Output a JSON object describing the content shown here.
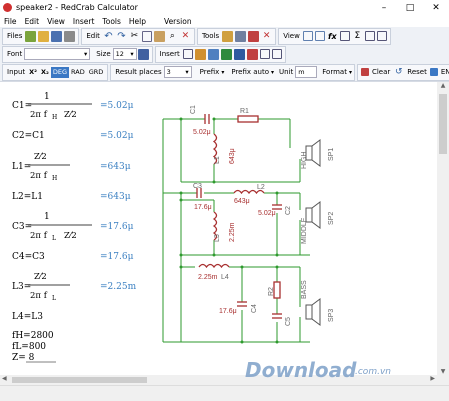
{
  "window": {
    "title": "speaker2 - RedCrab Calculator",
    "minimize": "–",
    "maximize": "□",
    "close": "✕"
  },
  "menu": [
    "File",
    "Edit",
    "View",
    "Insert",
    "Tools",
    "Help",
    "Version"
  ],
  "toolbar1": {
    "files": "Files",
    "edit": "Edit",
    "tools": "Tools",
    "view": "View",
    "fx": "fx"
  },
  "toolbar2": {
    "font_label": "Font",
    "size_label": "Size",
    "size_value": "12",
    "insert_label": "Insert"
  },
  "toolbar3": {
    "input": "Input",
    "x2": "X²",
    "x_sub": "X₂",
    "deg": "DEG",
    "rad": "RAD",
    "grd": "GRD",
    "result_places": "Result places",
    "result_value": "3",
    "prefix": "Prefix",
    "prefix_auto": "Prefix auto",
    "unit": "Unit",
    "unit_value": "m",
    "format": "Format",
    "clear": "Clear",
    "reset": "Reset",
    "enter": "ENTER"
  },
  "formulas": {
    "c1_label": "C1=",
    "one": "1",
    "two_pi_fh": "2π f",
    "sub_h": "H",
    "z_sqrt2": "Z⁄2",
    "c1_result": "=5.02μ",
    "c2_text": "C2=C1",
    "c2_result": "=5.02μ",
    "l1_label": "L1=",
    "z_over": "Z⁄2",
    "fh": "f",
    "l1_result": "=643μ",
    "l2_text": "L2=L1",
    "l2_result": "=643μ",
    "c3_label": "C3=",
    "sub_l": "L",
    "c3_result": "=17.6μ",
    "c4_text": "C4=C3",
    "c4_result": "=17.6μ",
    "l3_label": "L3=",
    "l3_result": "=2.25m",
    "l4_text": "L4=L3",
    "fh_assign": "fH=2800",
    "fl_assign": "fL=800",
    "z_assign": "Z= 8"
  },
  "circuit": {
    "c1": "C1",
    "c1_val": "5.02μ",
    "r1": "R1",
    "l1": "L1",
    "l1_val": "643μ",
    "high": "HIGH",
    "sp1": "SP1",
    "c3": "C3",
    "c3_val": "17.6μ",
    "l2": "L2",
    "l2_val": "643μ",
    "c2": "C2",
    "c2_val": "5.02μ",
    "l3": "L3",
    "l3_val": "2.25m",
    "middle": "MIDDLE",
    "sp2": "SP2",
    "l4_val": "2.25m",
    "l4": "L4",
    "c4_val": "17.6μ",
    "c4": "C4",
    "r2": "R2",
    "c5": "C5",
    "bass": "BASS",
    "sp3": "SP3"
  },
  "watermark": {
    "main": "Download",
    "domain": ".com.vn"
  },
  "colors": {
    "result_blue": "#3a7fc1",
    "circuit_green": "#2e9a2e",
    "component_red": "#a83030",
    "label_gray": "#666"
  }
}
